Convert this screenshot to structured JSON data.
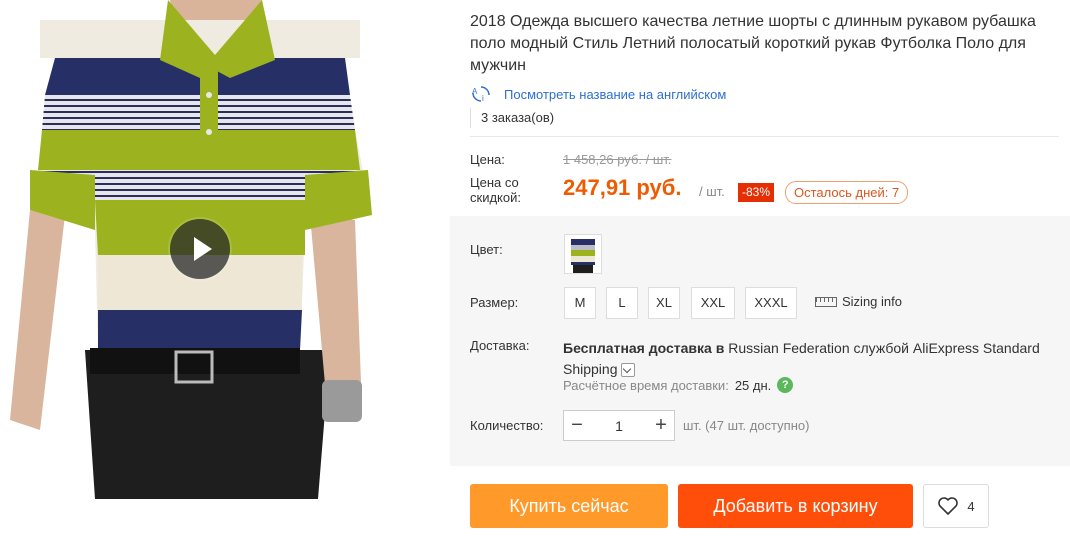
{
  "product": {
    "title": "2018 Одежда высшего качества летние шорты с длинным рукавом рубашка поло модный Стиль Летний полосатый короткий рукав Футболка Поло для мужчин",
    "translate_link": "Посмотреть название на английском",
    "orders": "3 заказа(ов)"
  },
  "price": {
    "label": "Цена:",
    "old": "1 458,26 руб. / шт.",
    "discount_label_line1": "Цена со",
    "discount_label_line2": "скидкой:",
    "new": "247,91 руб.",
    "per_unit": "/ шт.",
    "discount_badge": "-83%",
    "days_left": "Осталось дней: 7"
  },
  "color": {
    "label": "Цвет:"
  },
  "size": {
    "label": "Размер:",
    "options": [
      "M",
      "L",
      "XL",
      "XXL",
      "XXXL"
    ],
    "sizing_info": "Sizing info"
  },
  "shipping": {
    "label": "Доставка:",
    "free": "Бесплатная доставка в",
    "country": "Russian Federation",
    "via": "службой",
    "service": "AliExpress Standard Shipping",
    "time_label": "Расчётное время доставки:",
    "time_value": "25 дн.",
    "help_icon": "?"
  },
  "quantity": {
    "label": "Количество:",
    "minus": "−",
    "value": "1",
    "plus": "+",
    "available": "шт. (47 шт. доступно)"
  },
  "actions": {
    "buy_now": "Купить сейчас",
    "add_to_cart": "Добавить в корзину",
    "wishlist_count": "4"
  },
  "colors": {
    "price_accent": "#f05a00",
    "buy_button": "#ff9a2a",
    "cart_button": "#ff4e0a",
    "discount_badge": "#e62e04",
    "link": "#2e6fd0"
  }
}
